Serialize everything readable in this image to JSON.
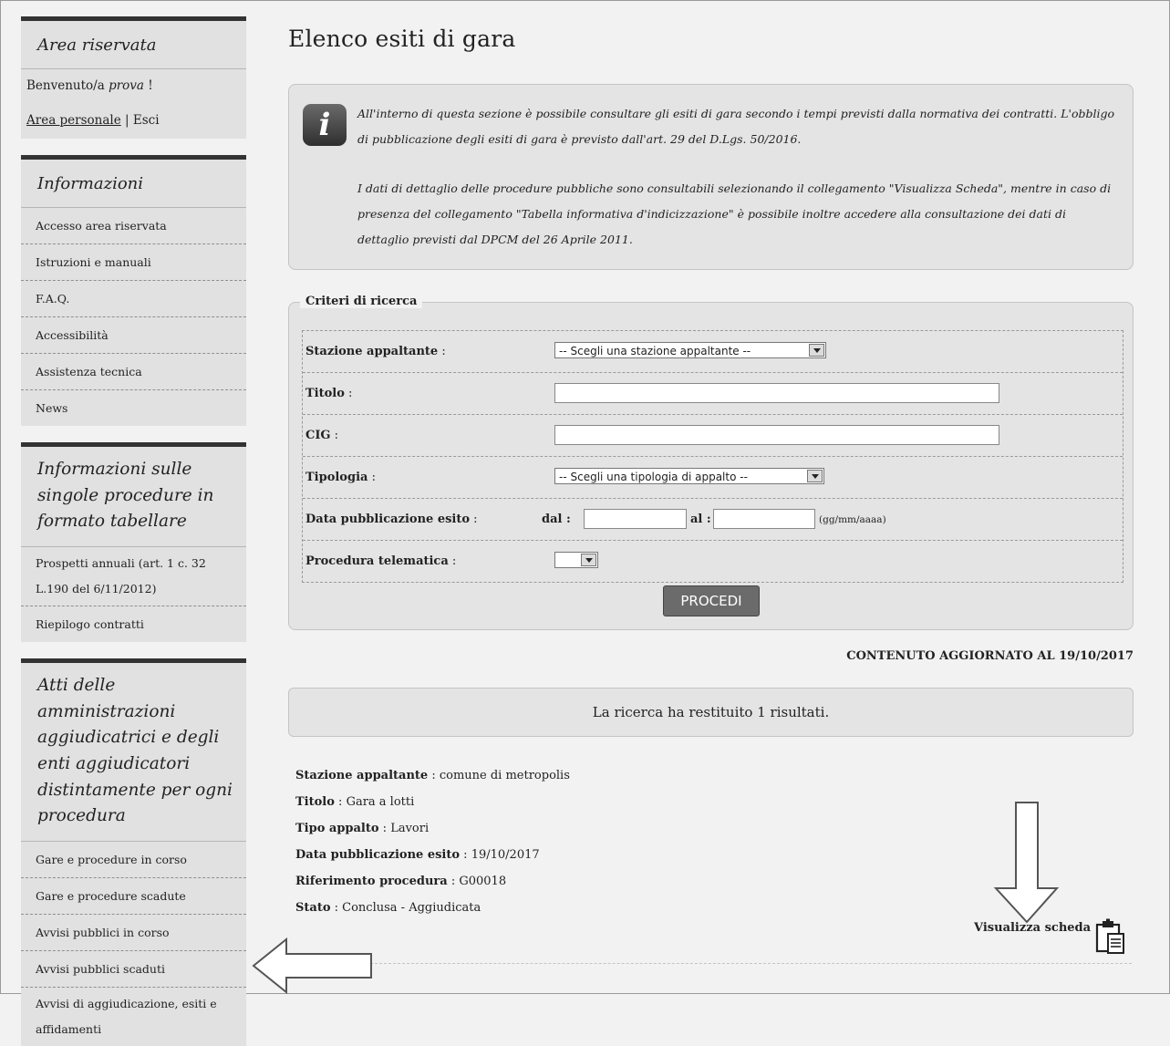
{
  "sidebar": {
    "reserved": {
      "title": "Area riservata",
      "welcome_prefix": "Benvenuto/a ",
      "welcome_user": "prova",
      "welcome_suffix": " !",
      "personal_link": "Area personale",
      "separator": " | ",
      "logout": "Esci"
    },
    "info": {
      "title": "Informazioni",
      "items": [
        "Accesso area riservata",
        "Istruzioni e manuali",
        "F.A.Q.",
        "Accessibilità",
        "Assistenza tecnica",
        "News"
      ]
    },
    "procedures": {
      "title": "Informazioni sulle singole procedure in formato tabellare",
      "items": [
        "Prospetti annuali (art. 1 c. 32 L.190 del 6/11/2012)",
        "Riepilogo contratti"
      ]
    },
    "acts": {
      "title": "Atti delle amministrazioni aggiudicatrici e degli enti aggiudicatori distintamente per ogni procedura",
      "items": [
        "Gare e procedure in corso",
        "Gare e procedure scadute",
        "Avvisi pubblici in corso",
        "Avvisi pubblici scaduti",
        "Avvisi di aggiudicazione, esiti e affidamenti"
      ]
    }
  },
  "main": {
    "title": "Elenco esiti di gara",
    "info": {
      "icon": "info-icon",
      "p1": "All'interno di questa sezione è possibile consultare gli esiti di gara secondo i tempi previsti dalla normativa dei contratti. L'obbligo di pubblicazione degli esiti di gara è previsto dall'art. 29 del D.Lgs. 50/2016.",
      "p2": "I dati di dettaglio delle procedure pubbliche sono consultabili selezionando il collegamento \"Visualizza Scheda\", mentre in caso di presenza del collegamento \"Tabella informativa d'indicizzazione\" è possibile inoltre accedere alla consultazione dei dati di dettaglio previsti dal DPCM del 26 Aprile 2011."
    },
    "search": {
      "legend": "Criteri di ricerca",
      "stazione_label": "Stazione appaltante",
      "stazione_value": "-- Scegli una stazione appaltante --",
      "titolo_label": "Titolo",
      "titolo_value": "",
      "cig_label": "CIG",
      "cig_value": "",
      "tipologia_label": "Tipologia",
      "tipologia_value": "-- Scegli una tipologia di appalto --",
      "data_label": "Data pubblicazione esito",
      "dal_label": "dal :",
      "al_label": "al :",
      "dal_value": "",
      "al_value": "",
      "date_format": "(gg/mm/aaaa)",
      "telematica_label": "Procedura telematica",
      "telematica_value": "",
      "colon": " :",
      "submit": "PROCEDI"
    },
    "updated": "CONTENUTO AGGIORNATO AL 19/10/2017",
    "results_text": "La ricerca ha restituito 1 risultati.",
    "result": {
      "fields": [
        {
          "label": "Stazione appaltante",
          "value": "comune di metropolis"
        },
        {
          "label": "Titolo",
          "value": "Gara a lotti"
        },
        {
          "label": "Tipo appalto",
          "value": "Lavori"
        },
        {
          "label": "Data pubblicazione esito",
          "value": "19/10/2017"
        },
        {
          "label": "Riferimento procedura",
          "value": "G00018"
        },
        {
          "label": "Stato",
          "value": "Conclusa - Aggiudicata"
        }
      ],
      "sep": " : ",
      "view_link": "Visualizza scheda",
      "view_icon": "clipboard-icon"
    }
  },
  "annotations": {
    "down_arrow": "arrow-down-icon",
    "left_arrow": "arrow-left-icon"
  }
}
